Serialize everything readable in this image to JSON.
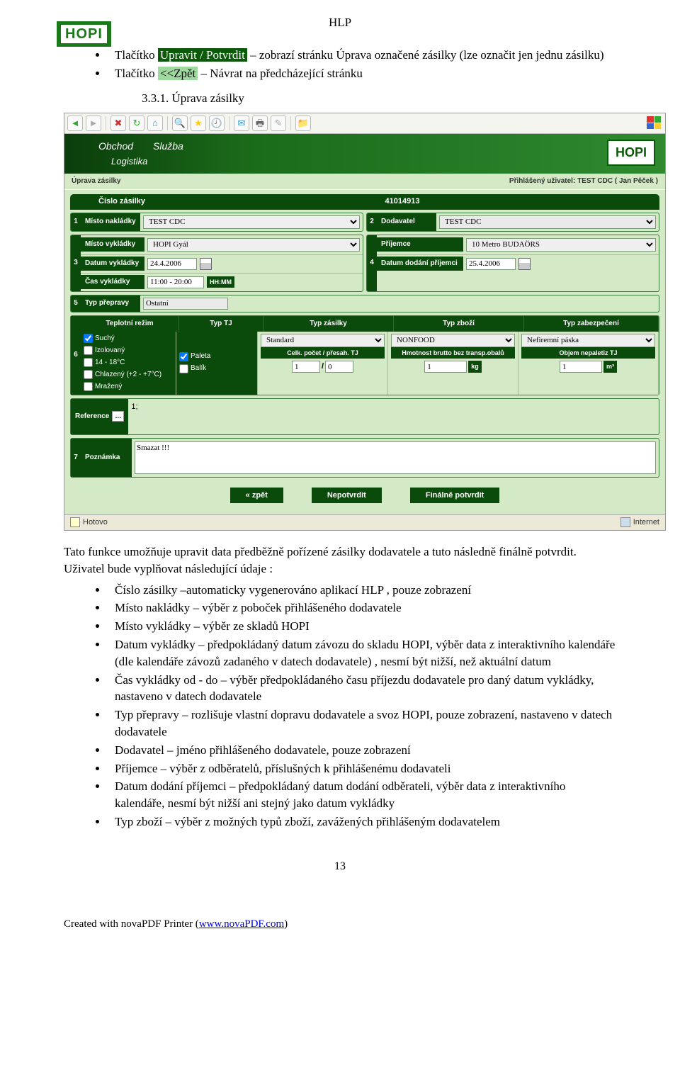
{
  "header_title": "HLP",
  "logo_text": "HOPI",
  "top_list": {
    "item1_prefix": "Tlačítko ",
    "item1_hl": "Upravit / Potvrdit",
    "item1_rest": " – zobrazí stránku Úprava označené zásilky (lze označit jen jednu zásilku)",
    "item2_prefix": "Tlačítko ",
    "item2_hl": "<<Zpět",
    "item2_rest": " – Návrat na předcházející stránku"
  },
  "section_number": "3.3.1.",
  "section_title": "Úprava zásilky",
  "screenshot": {
    "banner": {
      "t1a": "Obchod",
      "t1b": "Služba",
      "t2": "Logistika",
      "logo": "HOPI"
    },
    "infobar": {
      "left": "Úprava zásilky",
      "right": "Přihlášený uživatel: TEST CDC ( Jan Pěček )"
    },
    "row_cislo_label": "Číslo zásilky",
    "row_cislo_value": "41014913",
    "f1": {
      "num": "1",
      "label": "Místo nakládky",
      "value": "TEST CDC"
    },
    "f2": {
      "num": "2",
      "label": "Dodavatel",
      "value": "TEST CDC"
    },
    "f3": {
      "num": "3",
      "r1_label": "Místo vykládky",
      "r1_value": "HOPI Gyál",
      "r2_label": "Datum vykládky",
      "r2_value": "24.4.2006",
      "r3_label": "Čas vykládky",
      "r3_value": "11:00 - 20:00",
      "r3_unit": "HH:MM"
    },
    "f4": {
      "num": "4",
      "r1_label": "Příjemce",
      "r1_value": "10 Metro BUDAÖRS",
      "r2_label": "Datum dodání příjemci",
      "r2_value": "25.4.2006"
    },
    "f5": {
      "num": "5",
      "label": "Typ přepravy",
      "value": "Ostatní"
    },
    "sec6": {
      "num": "6",
      "h1": "Teplotní režim",
      "h2": "Typ TJ",
      "h3": "Typ zásilky",
      "h4": "Typ zboží",
      "h5": "Typ zabezpečení",
      "chk": [
        "Suchý",
        "Izolovaný",
        "14 - 18°C",
        "Chlazený (+2 - +7°C)",
        "Mražený"
      ],
      "tj": [
        "Paleta",
        "Balík"
      ],
      "sel_zasilka": "Standard",
      "sel_zbozi": "NONFOOD",
      "sel_zabezp": "Nefiremní páska",
      "sub_c": "Celk. počet / přesah. TJ",
      "sub_c_v1": "1",
      "sub_c_v2": "0",
      "sub_d": "Hmotnost brutto bez transp.obalů",
      "sub_d_v": "1",
      "sub_d_u": "kg",
      "sub_e": "Objem nepaletiz TJ",
      "sub_e_v": "1",
      "sub_e_u": "m³"
    },
    "ref": {
      "label": "Reference",
      "value": "1;"
    },
    "note": {
      "num": "7",
      "label": "Poznámka",
      "value": "Smazat !!!"
    },
    "buttons": {
      "back": "« zpět",
      "nepotvrdit": "Nepotvrdit",
      "finalne": "Finálně potvrdit"
    },
    "status": {
      "left": "Hotovo",
      "right": "Internet"
    }
  },
  "paragraph": "Tato funkce umožňuje upravit data předběžně pořízené zásilky dodavatele a tuto následně finálně potvrdit. Uživatel bude vyplňovat následující údaje :",
  "body_list": [
    "Číslo zásilky –automaticky vygenerováno aplikací HLP , pouze zobrazení",
    "Místo nakládky – výběr z poboček přihlášeného dodavatele",
    "Místo vykládky – výběr ze skladů HOPI",
    "Datum vykládky – předpokládaný datum závozu do skladu HOPI, výběr data z interaktivního kalendáře (dle kalendáře závozů zadaného v datech dodavatele) , nesmí být nižší, než aktuální datum",
    "Čas vykládky od - do – výběr předpokládaného času příjezdu dodavatele pro daný datum vykládky, nastaveno v datech dodavatele",
    "Typ přepravy – rozlišuje vlastní dopravu dodavatele a svoz HOPI, pouze zobrazení, nastaveno v datech dodavatele",
    "Dodavatel – jméno přihlášeného dodavatele, pouze zobrazení",
    "Příjemce – výběr z odběratelů, příslušných k přihlášenému dodavateli",
    "Datum dodání příjemci – předpokládaný datum dodání odběrateli, výběr data z interaktivního kalendáře, nesmí být nižší ani stejný jako datum vykládky",
    "Typ zboží – výběr z možných typů zboží, zavážených přihlášeným dodavatelem"
  ],
  "page_number": "13",
  "footer_prefix": "Created with novaPDF Printer (",
  "footer_link": "www.novaPDF.com",
  "footer_suffix": ")"
}
